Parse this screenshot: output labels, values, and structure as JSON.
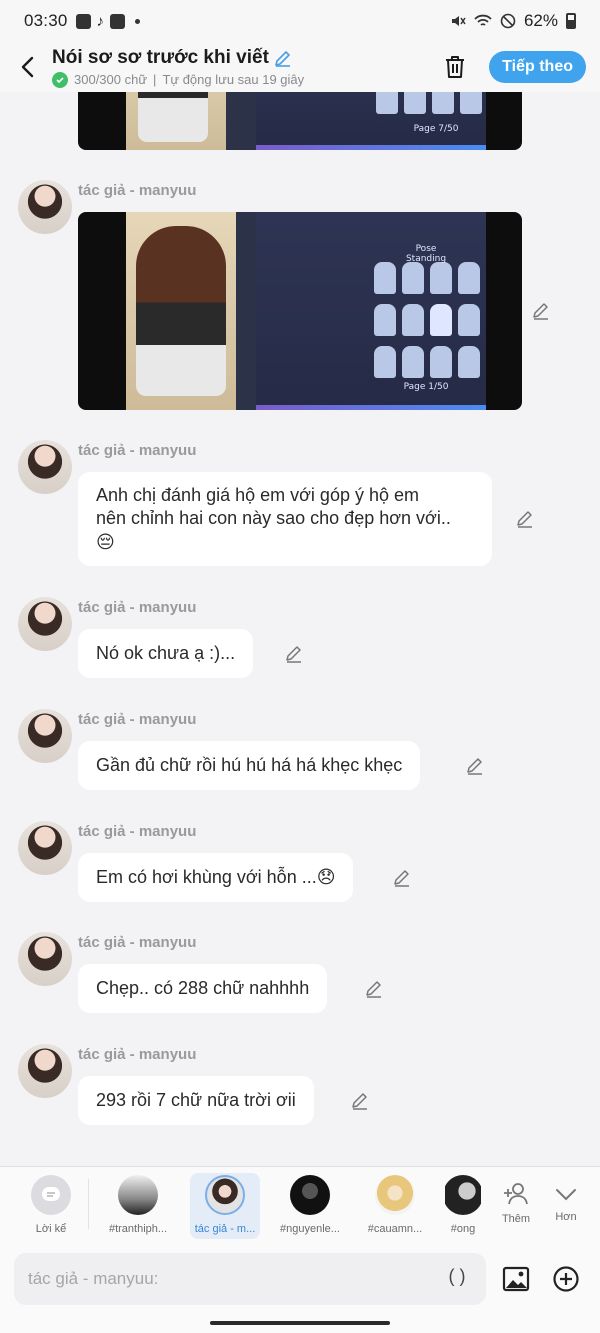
{
  "status_bar": {
    "time": "03:30",
    "battery": "62%"
  },
  "header": {
    "title": "Nói sơ sơ trước khi viết",
    "word_count": "300/300 chữ",
    "separator": "|",
    "autosave": "Tự động lưu sau 19 giây",
    "next_label": "Tiếp theo"
  },
  "messages": [
    {
      "author": "tác giả - manyuu",
      "type": "image"
    },
    {
      "author": "tác giả - manyuu",
      "line1": "Anh chị đánh giá hộ em với góp ý hộ em",
      "line2": "nên chỉnh hai con này sao cho đẹp hơn với..",
      "emoji": "😔"
    },
    {
      "author": "tác giả - manyuu",
      "text": "Nó ok chưa ạ :)..."
    },
    {
      "author": "tác giả - manyuu",
      "text": "Gần đủ chữ rồi hú hú há há khẹc khẹc"
    },
    {
      "author": "tác giả - manyuu",
      "text": "Em có hơi khùng với hỗn ...😞"
    },
    {
      "author": "tác giả - manyuu",
      "text": "Chẹp.. có 288 chữ nahhhh"
    },
    {
      "author": "tác giả - manyuu",
      "text": "293 rồi 7 chữ nữa trời ơii"
    }
  ],
  "game_labels": {
    "page_top": "Page 7/50",
    "page_bottom": "Page 1/50",
    "pose": "Pose Standing"
  },
  "chips": [
    {
      "label": "Lời kể",
      "icon": "narration-icon"
    },
    {
      "label": "#tranthiph..."
    },
    {
      "label": "tác giả - m...",
      "active": true
    },
    {
      "label": "#nguyenle..."
    },
    {
      "label": "#cauamn..."
    },
    {
      "label": "#ong"
    },
    {
      "label": "Thêm",
      "icon": "add-person-icon"
    },
    {
      "label": "Hơn",
      "icon": "chevron-down-icon"
    }
  ],
  "input": {
    "placeholder": "tác giả - manyuu:",
    "paren_label": "( )"
  },
  "colors": {
    "accent": "#3fa3ee",
    "check": "#3fbf6a",
    "background": "#f3f3f5"
  }
}
